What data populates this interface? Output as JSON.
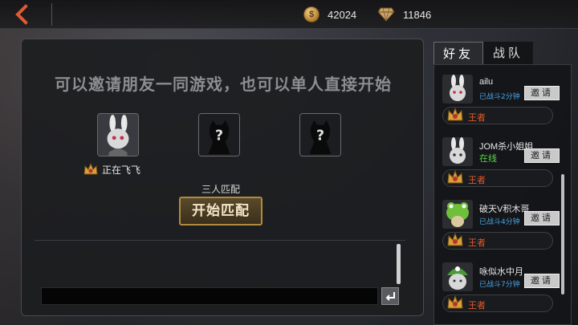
{
  "topbar": {
    "coins": "42024",
    "gems": "11846"
  },
  "main": {
    "invite_text": "可以邀请朋友一同游戏，也可以单人直接开始",
    "player_status": "正在飞飞",
    "match_label": "三人匹配",
    "start_label": "开始匹配",
    "empty_slot_symbol": "?"
  },
  "friends_panel": {
    "tabs": [
      {
        "label": "好友"
      },
      {
        "label": "战队"
      }
    ],
    "invite_label": "邀请",
    "friends": [
      {
        "name": "ailu",
        "status": "已战斗2分钟",
        "rank": "王者",
        "avatar": "bunny-avatar"
      },
      {
        "name": "JOM杀小姐姐",
        "status": "在线",
        "rank": "王者",
        "avatar": "bunny-avatar"
      },
      {
        "name": "破天V积木哥",
        "status": "已战斗4分钟",
        "rank": "王者",
        "avatar": "frog-avatar"
      },
      {
        "name": "咏似水中月",
        "status": "已战斗7分钟",
        "rank": "王者",
        "avatar": "green-hat-avatar"
      }
    ]
  },
  "colors": {
    "accent_orange": "#e05a35",
    "gold": "#b08a3e",
    "online_green": "#5ad24a",
    "battle_blue": "#4aa3e0"
  }
}
